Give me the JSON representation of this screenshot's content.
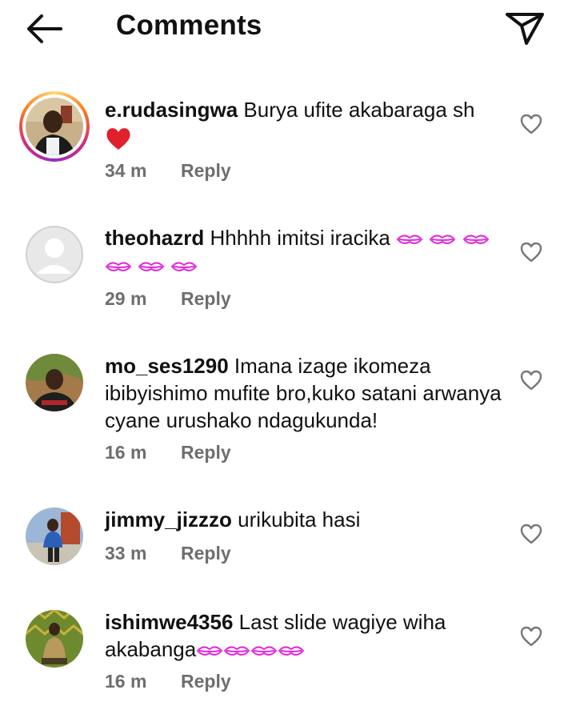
{
  "header": {
    "title": "Comments"
  },
  "comments": [
    {
      "username": "e.rudasingwa",
      "text": "Burya ufite akabaraga sh",
      "time": "34 m",
      "reply": "Reply"
    },
    {
      "username": "theohazrd",
      "text": "Hhhhh imitsi iracika",
      "time": "29 m",
      "reply": "Reply"
    },
    {
      "username": "mo_ses1290",
      "text": "Imana izage ikomeza ibibyishimo mufite bro,kuko satani arwanya cyane urushako ndagukunda!",
      "time": "16 m",
      "reply": "Reply"
    },
    {
      "username": "jimmy_jizzzo",
      "text": "urikubita hasi",
      "time": "33 m",
      "reply": "Reply"
    },
    {
      "username": "ishimwe4356",
      "text": "Last slide wagiye wiha akabanga",
      "time": "16 m",
      "reply": "Reply"
    }
  ],
  "icons": {
    "back": "arrow-left-icon",
    "share": "paper-plane-icon",
    "like": "heart-outline-icon",
    "emoji": "kissing-lips-emoji",
    "heart": "red-heart-emoji"
  },
  "colors": {
    "accent_heart": "#e0202c",
    "emoji_pink": "#e02ad8",
    "meta_gray": "#6e6e6e"
  }
}
